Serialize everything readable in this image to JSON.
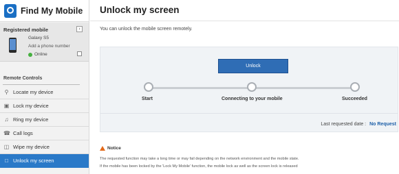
{
  "app": {
    "title": "Find My Mobile"
  },
  "registered": {
    "heading": "Registered mobile",
    "device_name": "Galaxy S5",
    "add_phone": "Add a phone number",
    "status": "Online"
  },
  "sidebar": {
    "section_title": "Remote Controls",
    "items": [
      {
        "label": "Locate my device",
        "icon": "search-icon"
      },
      {
        "label": "Lock my device",
        "icon": "lock-icon"
      },
      {
        "label": "Ring my device",
        "icon": "music-note-icon"
      },
      {
        "label": "Call logs",
        "icon": "phone-log-icon"
      },
      {
        "label": "Wipe my device",
        "icon": "trash-icon"
      },
      {
        "label": "Unlock my screen",
        "icon": "unlock-icon",
        "active": true
      }
    ]
  },
  "main": {
    "title": "Unlock my screen",
    "intro": "You can unlock the mobile screen remotely.",
    "button_label": "Unlock",
    "steps": [
      "Start",
      "Connecting to your mobile",
      "Succeeded"
    ],
    "last_request_label": "Last requested date :",
    "last_request_value": "No Request",
    "notice_title": "Notice",
    "notice_lines": [
      "The requested function may take a long time or may fail depending on the network environment and the mobile state.",
      "If the mobile has been locked by the 'Lock My Mobile' function, the mobile lock as well as the screen lock is released"
    ]
  },
  "colors": {
    "accent": "#2a79c8",
    "button": "#2f6db5",
    "online": "#46b040",
    "warning": "#e36a1a"
  }
}
